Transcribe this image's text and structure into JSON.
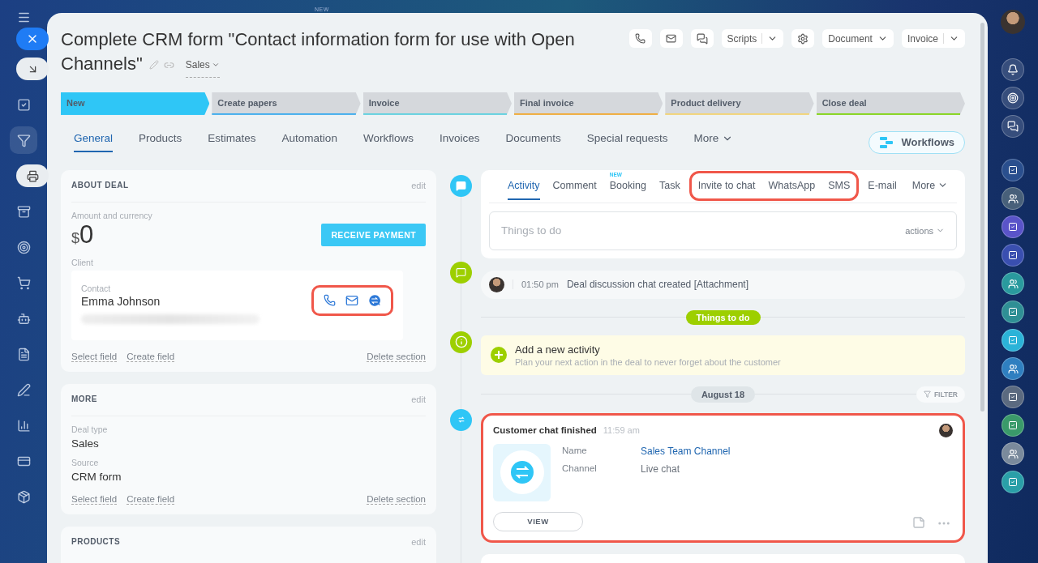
{
  "topbar": {
    "badge": "NEW"
  },
  "title": "Complete CRM form \"Contact information form for use with Open Channels\"",
  "pipeline": "Sales",
  "toolbar": {
    "scripts": "Scripts",
    "document": "Document",
    "invoice": "Invoice"
  },
  "stages": [
    {
      "label": "New",
      "selected": true,
      "color": "#2fc6f6"
    },
    {
      "label": "Create papers",
      "selected": false,
      "color": "#2fa8f0"
    },
    {
      "label": "Invoice",
      "selected": false,
      "color": "#55d0e0"
    },
    {
      "label": "Final invoice",
      "selected": false,
      "color": "#f5a623"
    },
    {
      "label": "Product delivery",
      "selected": false,
      "color": "#f7d46a"
    },
    {
      "label": "Close deal",
      "selected": false,
      "color": "#7bd500"
    }
  ],
  "tabs": [
    {
      "label": "General",
      "selected": true
    },
    {
      "label": "Products",
      "selected": false
    },
    {
      "label": "Estimates",
      "selected": false
    },
    {
      "label": "Automation",
      "selected": false
    },
    {
      "label": "Workflows",
      "selected": false
    },
    {
      "label": "Invoices",
      "selected": false
    },
    {
      "label": "Documents",
      "selected": false
    },
    {
      "label": "Special requests",
      "selected": false
    }
  ],
  "tabs_more": "More",
  "workflows_button": "Workflows",
  "about": {
    "title": "ABOUT DEAL",
    "edit": "edit",
    "amount_label": "Amount and currency",
    "currency": "$",
    "amount": "0",
    "payment_button": "RECEIVE PAYMENT",
    "client_label": "Client",
    "contact_label": "Contact",
    "contact_name": "Emma Johnson",
    "actions_highlighted": true,
    "links": [
      "Select field",
      "Create field"
    ],
    "delete": "Delete section"
  },
  "more": {
    "title": "MORE",
    "edit": "edit",
    "fields": [
      {
        "label": "Deal type",
        "value": "Sales"
      },
      {
        "label": "Source",
        "value": "CRM form"
      }
    ],
    "links": [
      "Select field",
      "Create field"
    ],
    "delete": "Delete section"
  },
  "products": {
    "title": "PRODUCTS",
    "edit": "edit"
  },
  "composer": {
    "tabs": [
      {
        "label": "Activity",
        "selected": true,
        "highlighted": false
      },
      {
        "label": "Comment",
        "selected": false,
        "highlighted": false
      },
      {
        "label": "Booking",
        "selected": false,
        "highlighted": false,
        "badge": "NEW"
      },
      {
        "label": "Task",
        "selected": false,
        "highlighted": false
      },
      {
        "label": "Invite to chat",
        "selected": false,
        "highlighted": true
      },
      {
        "label": "WhatsApp",
        "selected": false,
        "highlighted": true
      },
      {
        "label": "SMS",
        "selected": false,
        "highlighted": true
      },
      {
        "label": "E-mail",
        "selected": false,
        "highlighted": false
      }
    ],
    "more": "More",
    "placeholder": "Things to do",
    "actions": "actions"
  },
  "chat_item": {
    "time": "01:50 pm",
    "text": "Deal discussion chat created [Attachment]"
  },
  "todo_divider": "Things to do",
  "add_activity": {
    "title": "Add a new activity",
    "subtitle": "Plan your next action in the deal to never forget about the customer"
  },
  "date_divider": "August 18",
  "filter": "FILTER",
  "chat_card": {
    "title": "Customer chat finished",
    "time": "11:59 am",
    "highlighted": true,
    "fields": [
      {
        "label": "Name",
        "value": "Sales Team Channel",
        "kind": "link"
      },
      {
        "label": "Channel",
        "value": "Live chat",
        "kind": "text"
      }
    ],
    "button": "VIEW"
  }
}
